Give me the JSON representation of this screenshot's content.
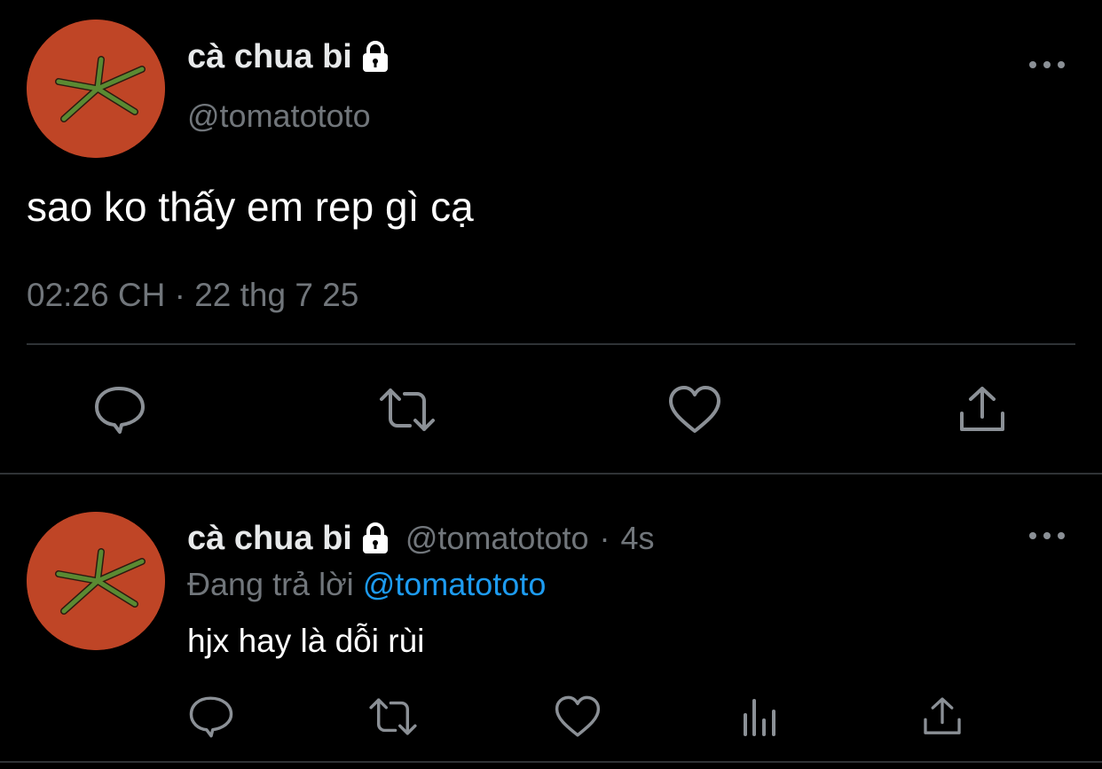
{
  "main_tweet": {
    "display_name": "cà chua bi",
    "handle": "@tomatototo",
    "text": "sao ko thấy em rep gì cạ",
    "timestamp": "02:26 CH · 22 thg 7 25",
    "locked": true,
    "actions": [
      "reply-icon",
      "retweet-icon",
      "like-icon",
      "share-icon"
    ]
  },
  "reply": {
    "display_name": "cà chua bi",
    "handle": "@tomatototo",
    "separator": "·",
    "age": "4s",
    "replying_prefix": "Đang trả lời",
    "replying_to": "@tomatototo",
    "text": "hjx hay là dỗi rùi",
    "actions": [
      "reply-icon",
      "retweet-icon",
      "like-icon",
      "views-icon",
      "share-icon"
    ]
  },
  "colors": {
    "background": "#000000",
    "avatar": "#bf4526",
    "leaf": "#5a8a32",
    "muted": "#71767b",
    "mention": "#1d9bf0",
    "divider": "#2f3336"
  }
}
